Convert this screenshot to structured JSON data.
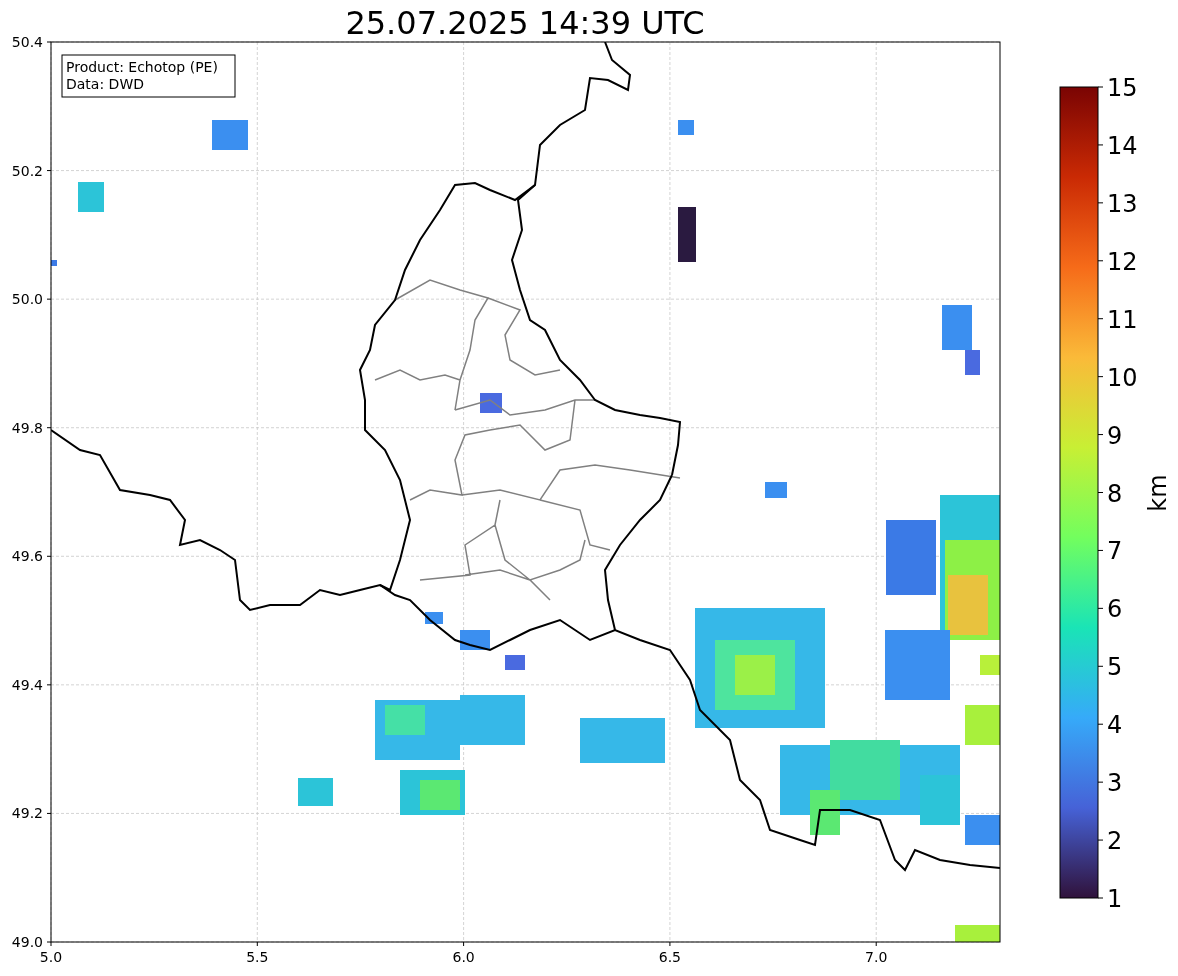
{
  "title": "25.07.2025 14:39 UTC",
  "info_box": [
    "Product: Echotop (PE)",
    "Data: DWD"
  ],
  "x_ticks": [
    "5.0",
    "5.5",
    "6.0",
    "6.5",
    "7.0"
  ],
  "y_ticks": [
    "50.4",
    "50.2",
    "50.0",
    "49.8",
    "49.6",
    "49.4",
    "49.2",
    "49.0"
  ],
  "colorbar": {
    "label": "km",
    "ticks": [
      "15",
      "14",
      "13",
      "12",
      "11",
      "10",
      "9",
      "8",
      "7",
      "6",
      "5",
      "4",
      "3",
      "2",
      "1"
    ]
  }
}
